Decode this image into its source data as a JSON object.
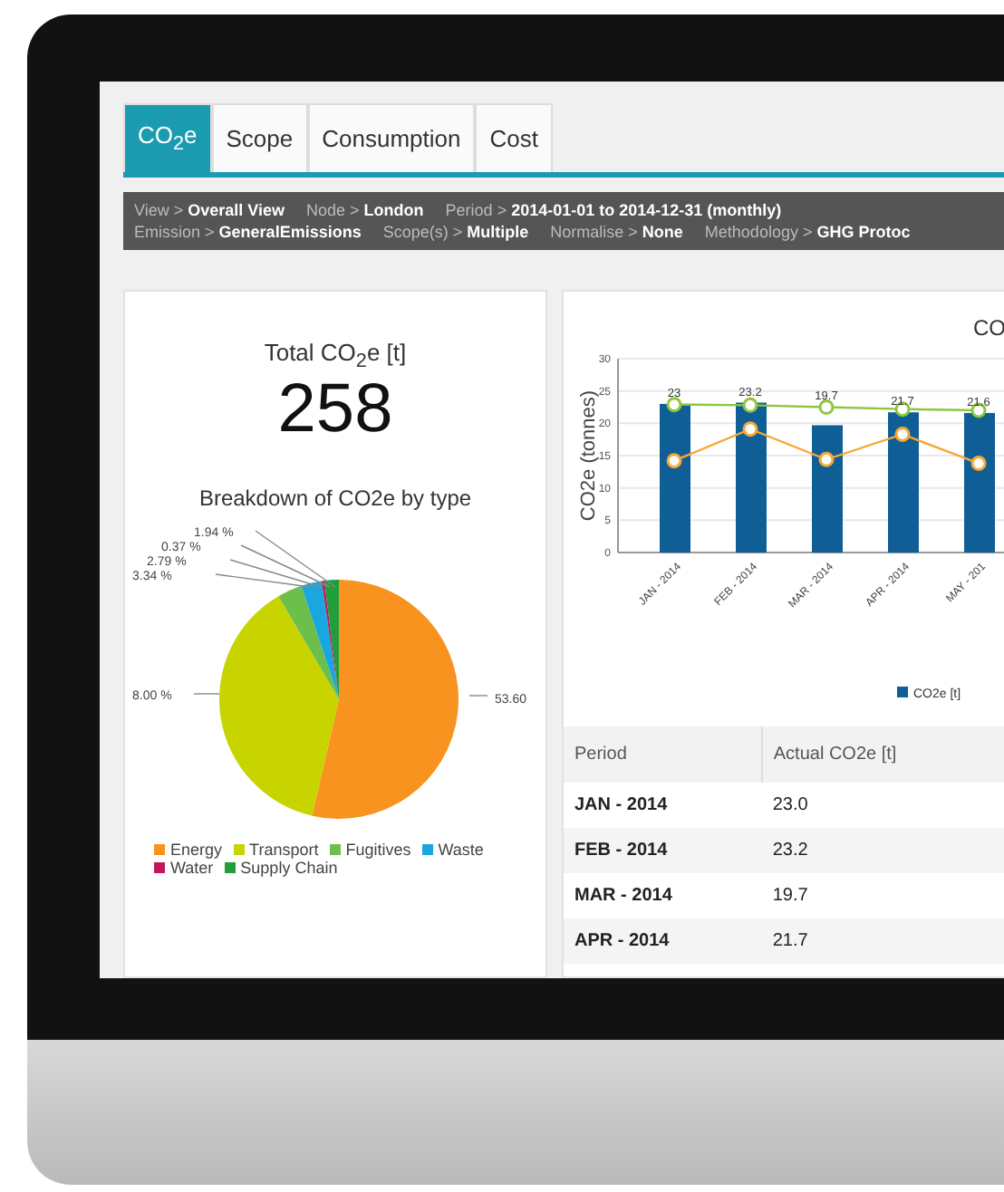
{
  "tabs": [
    {
      "label": "CO$_{2}$e",
      "selected": true
    },
    {
      "label": "Scope",
      "selected": false
    },
    {
      "label": "Consumption",
      "selected": false
    },
    {
      "label": "Cost",
      "selected": false
    }
  ],
  "info_bar": [
    [
      {
        "label": "View >",
        "value": "Overall View"
      },
      {
        "label": "Node >",
        "value": "London"
      },
      {
        "label": "Period >",
        "value": "2014-01-01 to 2014-12-31 (monthly)"
      }
    ],
    [
      {
        "label": "Emission >",
        "value": "GeneralEmissions"
      },
      {
        "label": "Scope(s) >",
        "value": "Multiple"
      },
      {
        "label": "Normalise >",
        "value": "None"
      },
      {
        "label": "Methodology >",
        "value": "GHG Protoc"
      }
    ]
  ],
  "total": {
    "label": "Total CO$_{2}$e [t]",
    "value": "258"
  },
  "breakdown": {
    "chart_data": {
      "type": "pie",
      "title": "Breakdown of CO2e by type",
      "categories": [
        "Energy",
        "Transport",
        "Fugitives",
        "Waste",
        "Water",
        "Supply Chain"
      ],
      "series": [
        {
          "values": [
            53.6,
            37.96,
            3.34,
            2.79,
            0.37,
            1.94
          ]
        }
      ],
      "colors": [
        "#f7931e",
        "#c8d400",
        "#6cc04a",
        "#1aa7e0",
        "#c2185b",
        "#1f9e3a"
      ],
      "value_labels": [
        "53.60",
        "8.00 %",
        "3.34 %",
        "2.79 %",
        "0.37 %",
        "1.94 %"
      ]
    }
  },
  "trend": {
    "chart_data": {
      "type": "bar",
      "title": "CO",
      "ylabel": "CO2e (tonnes)",
      "categories": [
        "JAN - 2014",
        "FEB - 2014",
        "MAR - 2014",
        "APR - 2014",
        "MAY - 201"
      ],
      "series": [
        {
          "name": "CO2e [t]",
          "color": "#0f5f96",
          "values": [
            23,
            23.2,
            19.7,
            21.7,
            21.6
          ]
        },
        {
          "type": "line",
          "marker": "circle",
          "color": "#8dc63f",
          "values": [
            22.9,
            22.8,
            22.5,
            22.2,
            22.0
          ]
        },
        {
          "type": "line",
          "marker": "circle",
          "color": "#f7a833",
          "values": [
            14.2,
            19.1,
            14.4,
            18.3,
            13.8
          ]
        }
      ],
      "grid": true,
      "ylim": [
        0,
        30
      ],
      "yticks": [
        0,
        5,
        10,
        15,
        20,
        25,
        30
      ],
      "value_labels": [
        "23",
        "23.2",
        "19.7",
        "21.7",
        "21.6"
      ]
    }
  },
  "table": {
    "columns": [
      "Period",
      "Actual CO2e [t]"
    ],
    "rows": [
      [
        "JAN - 2014",
        "23.0"
      ],
      [
        "FEB - 2014",
        "23.2"
      ],
      [
        "MAR - 2014",
        "19.7"
      ],
      [
        "APR - 2014",
        "21.7"
      ]
    ]
  }
}
